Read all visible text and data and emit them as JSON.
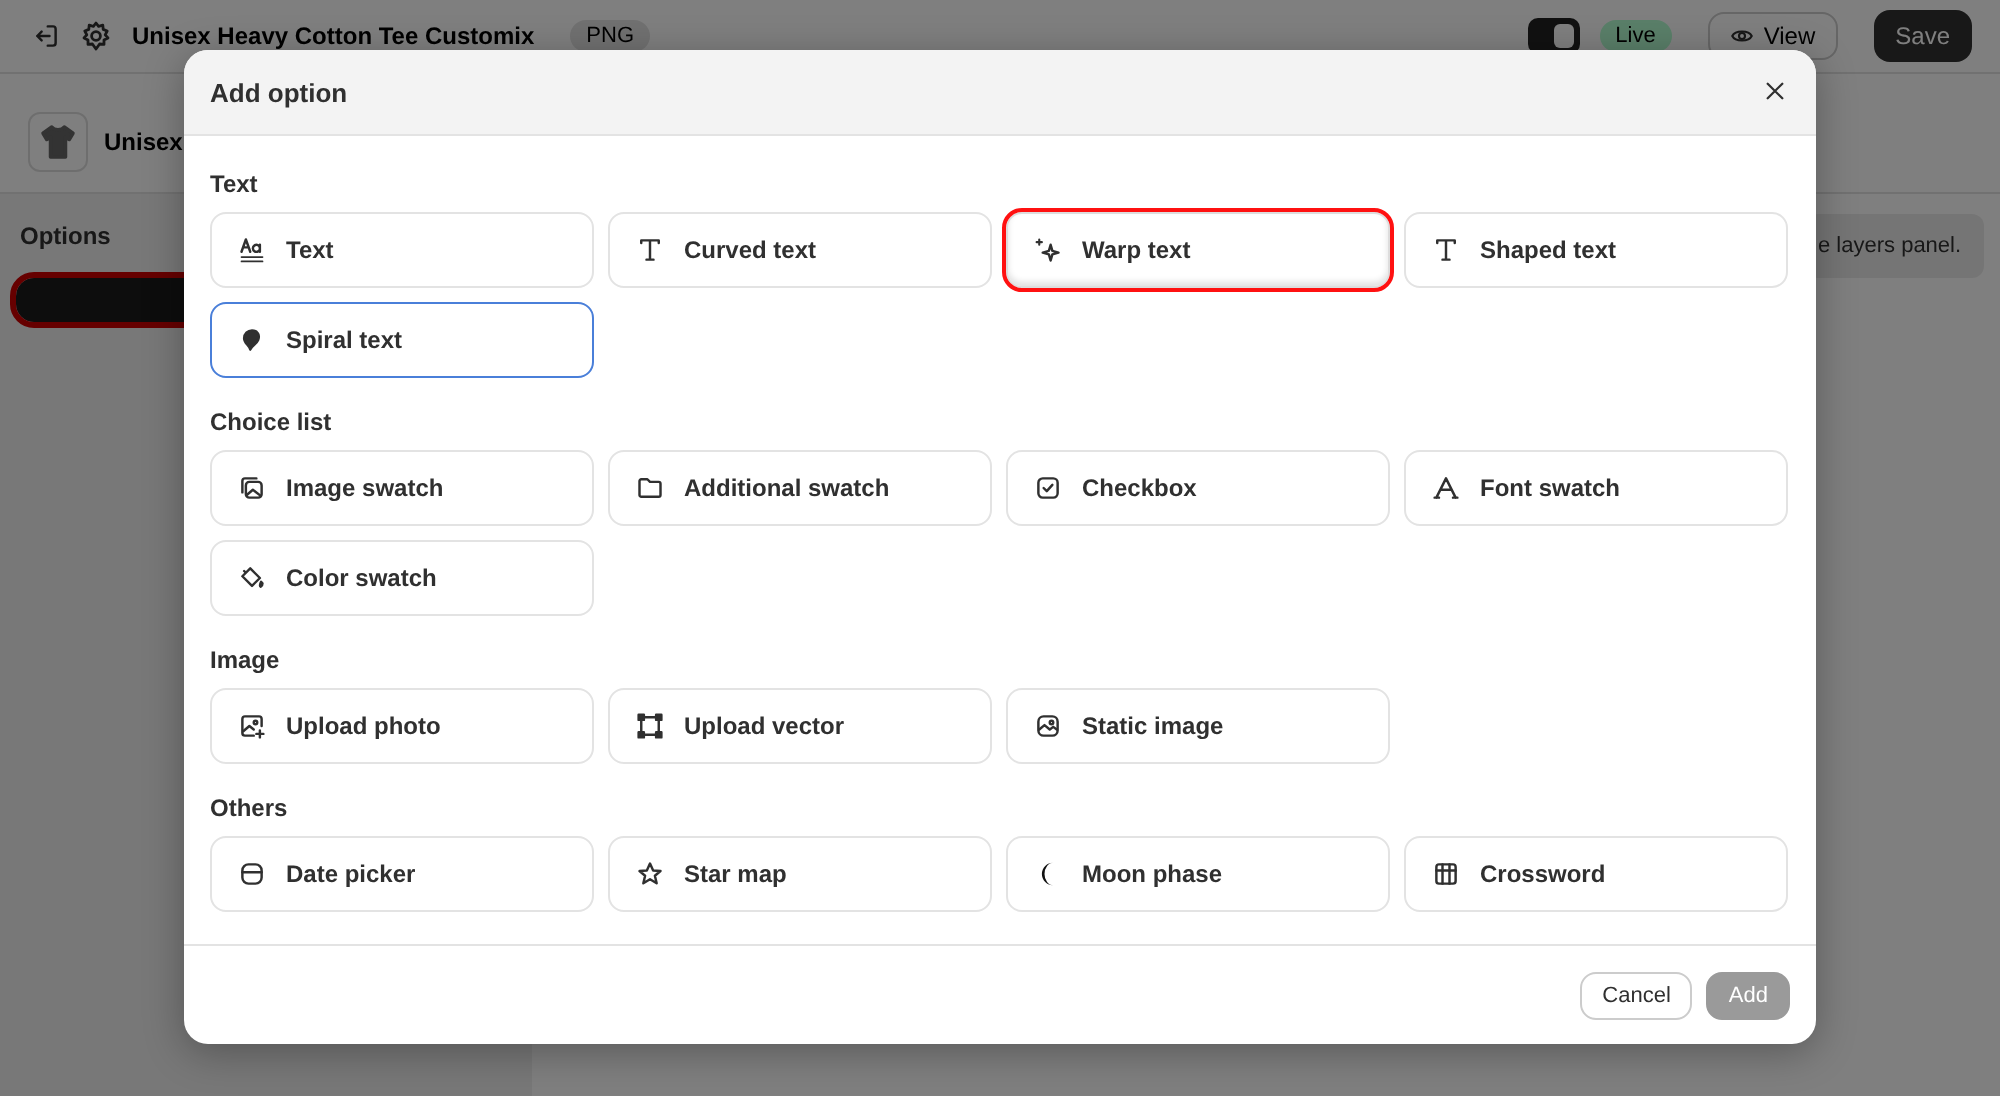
{
  "top_bar": {
    "title": "Unisex Heavy Cotton Tee Customix",
    "format_badge": "PNG",
    "live_toggle": {
      "on": true
    },
    "status_badge": "Live",
    "view_button": "View",
    "save_button": "Save"
  },
  "product": {
    "name": "Unisex"
  },
  "sidebar": {
    "title": "Options",
    "option_button": {
      "highlighted": true
    }
  },
  "right_panel": {
    "hint": "e layers panel."
  },
  "dialog": {
    "title": "Add option",
    "sections": [
      {
        "title": "Text",
        "items": [
          {
            "label": "Text",
            "highlighted": false,
            "focused": false
          },
          {
            "label": "Curved text",
            "highlighted": false,
            "focused": false
          },
          {
            "label": "Warp text",
            "highlighted": true,
            "focused": false
          },
          {
            "label": "Shaped text",
            "highlighted": false,
            "focused": false
          },
          {
            "label": "Spiral text",
            "highlighted": false,
            "focused": true
          }
        ]
      },
      {
        "title": "Choice list",
        "items": [
          {
            "label": "Image swatch",
            "highlighted": false,
            "focused": false
          },
          {
            "label": "Additional swatch",
            "highlighted": false,
            "focused": false
          },
          {
            "label": "Checkbox",
            "highlighted": false,
            "focused": false
          },
          {
            "label": "Font swatch",
            "highlighted": false,
            "focused": false
          },
          {
            "label": "Color swatch",
            "highlighted": false,
            "focused": false
          }
        ]
      },
      {
        "title": "Image",
        "items": [
          {
            "label": "Upload photo",
            "highlighted": false,
            "focused": false
          },
          {
            "label": "Upload vector",
            "highlighted": false,
            "focused": false
          },
          {
            "label": "Static image",
            "highlighted": false,
            "focused": false
          }
        ]
      },
      {
        "title": "Others",
        "items": [
          {
            "label": "Date picker",
            "highlighted": false,
            "focused": false
          },
          {
            "label": "Star map",
            "highlighted": false,
            "focused": false
          },
          {
            "label": "Moon phase",
            "highlighted": false,
            "focused": false
          },
          {
            "label": "Crossword",
            "highlighted": false,
            "focused": false
          }
        ]
      }
    ],
    "buttons": [
      {
        "label": "Cancel",
        "disabled": false
      },
      {
        "label": "Add",
        "disabled": true
      }
    ]
  }
}
